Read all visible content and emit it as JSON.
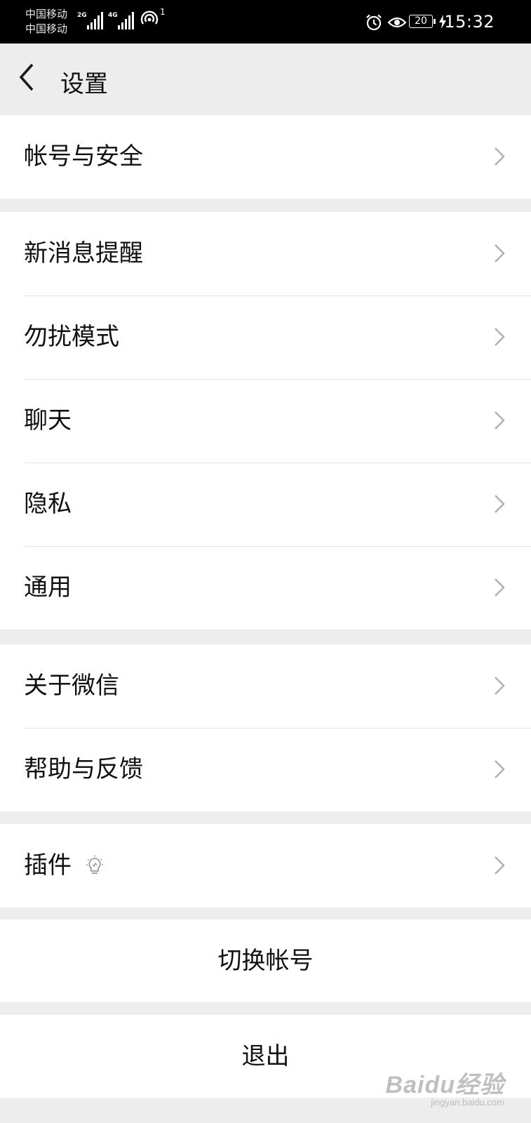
{
  "status_bar": {
    "carriers": [
      "中国移动",
      "中国移动"
    ],
    "signal1_tag": "2G",
    "signal2_tag": "4G",
    "hotspot_count": "1",
    "battery_level": "20",
    "time": "15:32",
    "icons": [
      "alarm-icon",
      "eye-icon",
      "battery-icon",
      "charging-bolt-icon"
    ]
  },
  "nav": {
    "title": "设置",
    "back_icon": "chevron-left-icon"
  },
  "groups": [
    {
      "items": [
        {
          "label": "帐号与安全"
        }
      ]
    },
    {
      "items": [
        {
          "label": "新消息提醒"
        },
        {
          "label": "勿扰模式"
        },
        {
          "label": "聊天"
        },
        {
          "label": "隐私"
        },
        {
          "label": "通用"
        }
      ]
    },
    {
      "items": [
        {
          "label": "关于微信"
        },
        {
          "label": "帮助与反馈"
        }
      ]
    },
    {
      "items": [
        {
          "label": "插件",
          "icon": "lightbulb-icon"
        }
      ]
    }
  ],
  "actions": {
    "switch_account": "切换帐号",
    "logout": "退出"
  },
  "watermark": {
    "main": "Baidu经验",
    "sub": "jingyan.baidu.com"
  },
  "colors": {
    "background": "#ededed",
    "card": "#ffffff",
    "chevron": "#b2b2b2",
    "statusbar": "#000000"
  }
}
